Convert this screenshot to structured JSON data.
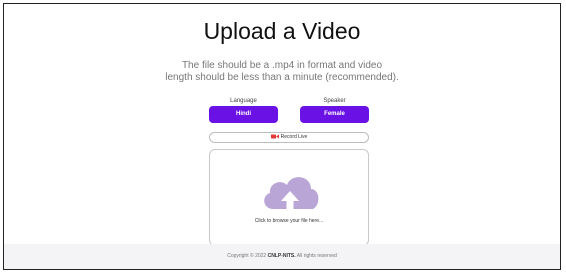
{
  "page": {
    "title": "Upload a Video",
    "subtitle_line1": "The file should be a .mp4 in format and video",
    "subtitle_line2": "length should be less than a minute (recommended)."
  },
  "language": {
    "label": "Language",
    "value": "Hindi"
  },
  "speaker": {
    "label": "Speaker",
    "value": "Female"
  },
  "record": {
    "label": "Record Live",
    "icon": "video-camera-icon"
  },
  "upload": {
    "prompt": "Click to browse your file here...",
    "icon": "cloud-upload-icon"
  },
  "footer": {
    "prefix": "Copyright © 2022 ",
    "org": "CNLP-NITS.",
    "suffix": " All rights reserved"
  },
  "colors": {
    "accent": "#6a11e6",
    "record_icon": "#e53935",
    "cloud": "#b9a6d6"
  }
}
